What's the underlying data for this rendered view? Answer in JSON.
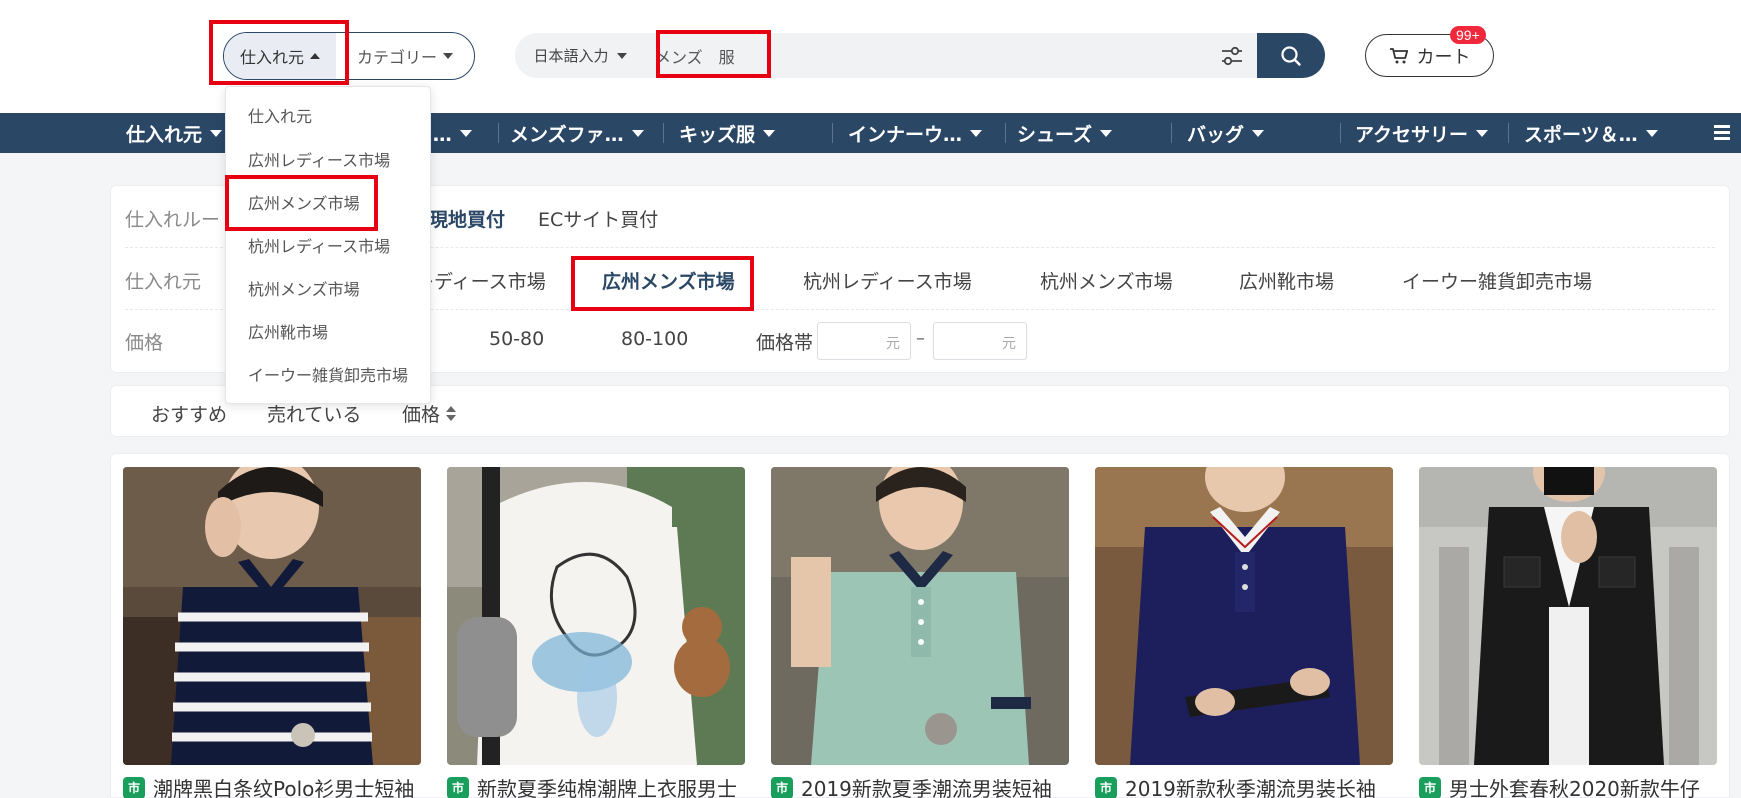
{
  "header": {
    "source_select": {
      "active": "仕入れ元",
      "category": "カテゴリー"
    },
    "search": {
      "language": "日本語入力",
      "value": "メンズ　服"
    },
    "cart": {
      "label": "カート",
      "badge": "99+"
    }
  },
  "nav": {
    "items": [
      "仕入れ元",
      "レディース…",
      "メンズファ…",
      "キッズ服",
      "インナーウ…",
      "シューズ",
      "バッグ",
      "アクセサリー",
      "スポーツ＆…"
    ]
  },
  "filters": {
    "route": {
      "label": "仕入れルー",
      "options": [
        "現地買付",
        "ECサイト買付"
      ]
    },
    "source": {
      "label": "仕入れ元",
      "options": [
        "広州レディース市場",
        "広州メンズ市場",
        "杭州レディース市場",
        "杭州メンズ市場",
        "広州靴市場",
        "イーウー雑貨卸売市場"
      ],
      "selected": "広州メンズ市場"
    },
    "price": {
      "label": "価格",
      "options": [
        "50-80",
        "80-100"
      ],
      "range_label": "価格帯",
      "unit": "元",
      "dash": "–"
    }
  },
  "sort": {
    "options": [
      "おすすめ",
      "売れている",
      "価格"
    ]
  },
  "dropdown": {
    "items": [
      "仕入れ元",
      "広州レディース市場",
      "広州メンズ市場",
      "杭州レディース市場",
      "杭州メンズ市場",
      "広州靴市場",
      "イーウー雑貨卸売市場"
    ],
    "highlighted": "広州メンズ市場"
  },
  "products": [
    {
      "title": "潮牌黑白条纹Polo衫男士短袖",
      "shop_icon": "市"
    },
    {
      "title": "新款夏季纯棉潮牌上衣服男士",
      "shop_icon": "市"
    },
    {
      "title": "2019新款夏季潮流男装短袖",
      "shop_icon": "市"
    },
    {
      "title": "2019新款秋季潮流男装长袖",
      "shop_icon": "市"
    },
    {
      "title": "男士外套春秋2020新款牛仔",
      "shop_icon": "市"
    }
  ],
  "colors": {
    "primary": "#2b4766",
    "highlight": "#e60012",
    "badge": "#f0283c",
    "shop": "#1a9e5c"
  }
}
